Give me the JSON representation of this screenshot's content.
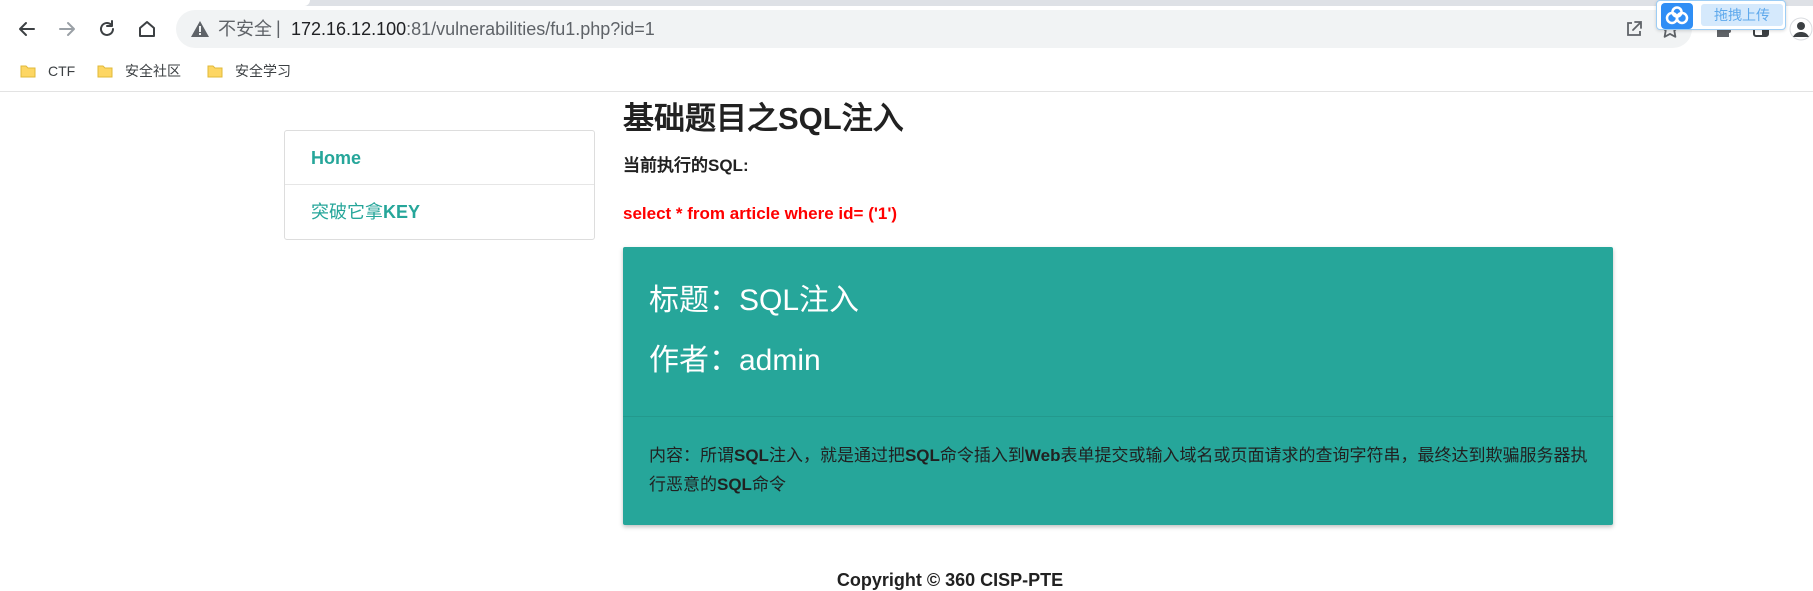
{
  "browser": {
    "back_icon": "arrow-left-icon",
    "forward_icon": "arrow-right-icon",
    "reload_icon": "reload-icon",
    "home_icon": "home-icon",
    "security_warning": "不安全",
    "separator": "|",
    "url_host": "172.16.12.100",
    "url_rest": ":81/vulnerabilities/fu1.php?id=1",
    "baidu_upload_label": "拖拽上传",
    "bookmarks": [
      {
        "label": "CTF"
      },
      {
        "label": "安全社区"
      },
      {
        "label": "安全学习"
      }
    ]
  },
  "sidebar": {
    "items": [
      {
        "label": "Home"
      },
      {
        "label_prefix": "突破它拿",
        "label_bold": "KEY"
      }
    ]
  },
  "main": {
    "title_prefix": "基础题目之",
    "title_bold": "SQL",
    "title_suffix": "注入",
    "sql_label": "当前执行的SQL:",
    "sql_text": "select * from article where id= ('1')",
    "card": {
      "title_line": "标题：SQL注入",
      "author_line": "作者：admin",
      "content": [
        {
          "t": "内容：所谓",
          "b": false
        },
        {
          "t": "SQL",
          "b": true
        },
        {
          "t": "注入，就是通过把",
          "b": false
        },
        {
          "t": "SQL",
          "b": true
        },
        {
          "t": "命令插入到",
          "b": false
        },
        {
          "t": "Web",
          "b": true
        },
        {
          "t": "表单提交或输入域名或页面请求的查询字符串，最终达到欺骗服务器执行恶意的",
          "b": false
        },
        {
          "t": "SQL",
          "b": true
        },
        {
          "t": "命令",
          "b": false
        }
      ]
    }
  },
  "footer": {
    "copyright": "Copyright © 360 CISP-PTE"
  },
  "colors": {
    "accent": "#26a69a",
    "sql_red": "#ff0000"
  }
}
